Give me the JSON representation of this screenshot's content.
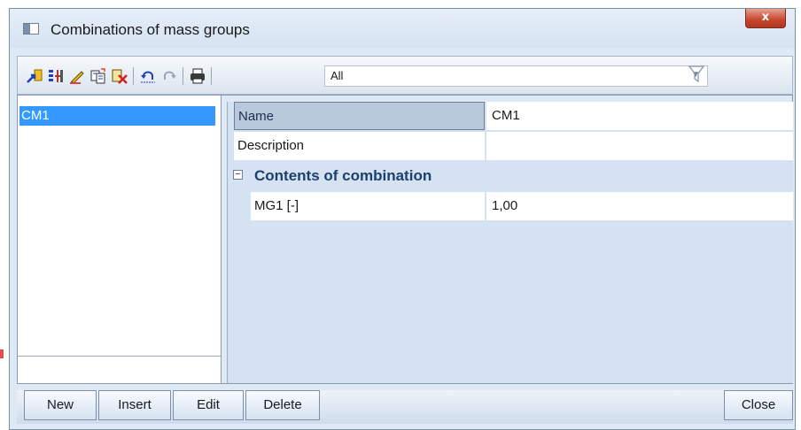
{
  "window": {
    "title": "Combinations of mass groups",
    "close_glyph": "x"
  },
  "toolbar": {
    "icons": [
      "new-arrow-icon",
      "properties-icon",
      "edit-pencil-icon",
      "copy-icon",
      "delete-icon",
      "undo-icon",
      "redo-icon",
      "print-icon"
    ],
    "filter_value": "All",
    "filter_icon": "funnel-icon"
  },
  "list": {
    "items": [
      "CM1"
    ]
  },
  "properties": {
    "name_label": "Name",
    "name_value": "CM1",
    "description_label": "Description",
    "description_value": "",
    "section_title": "Contents of combination",
    "section_toggle": "−",
    "mg1_label": "MG1 [-]",
    "mg1_value": "1,00"
  },
  "buttons": {
    "new": "New",
    "insert": "Insert",
    "edit": "Edit",
    "delete": "Delete",
    "close": "Close"
  },
  "colors": {
    "selection": "#3399ff",
    "section_title": "#1d3f6e",
    "close_button": "#c4452c"
  }
}
